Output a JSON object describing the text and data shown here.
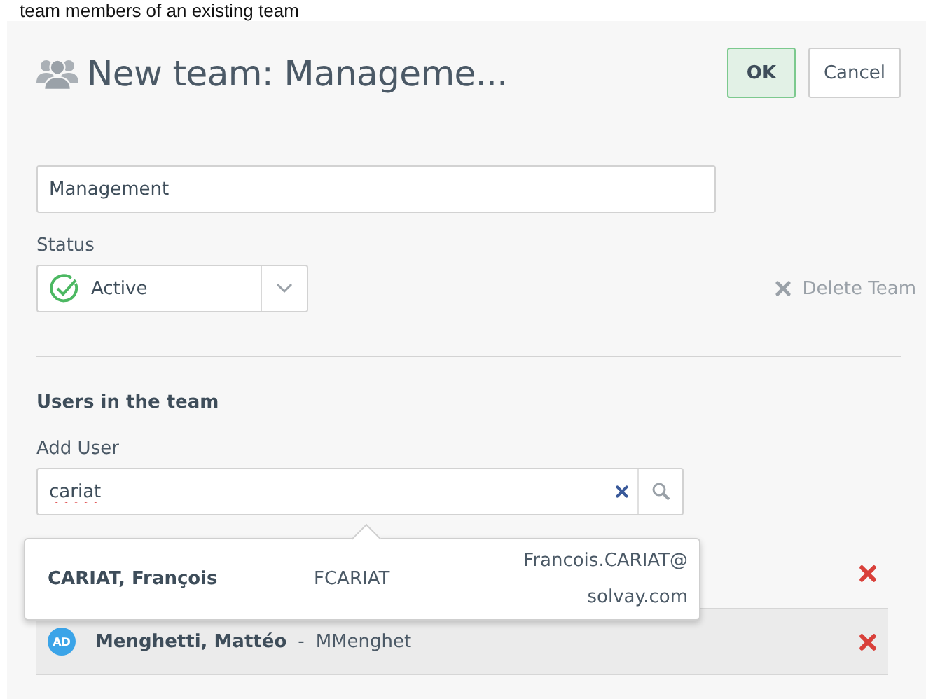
{
  "caption": "team members of an existing team",
  "header": {
    "title": "New team: Manageme...",
    "buttons": [
      {
        "label": "OK",
        "kind": "primary"
      },
      {
        "label": "Cancel",
        "kind": "secondary"
      }
    ]
  },
  "name_field": {
    "value": "Management"
  },
  "status": {
    "label": "Status",
    "value": "Active",
    "active": true
  },
  "delete_button": {
    "label": "Delete Team"
  },
  "users_section": {
    "title": "Users in the team",
    "add_label": "Add User",
    "search": {
      "value": "cariat",
      "misspelled": true
    }
  },
  "suggestion": {
    "name": "CARIAT, François",
    "login": "FCARIAT",
    "email_lines": [
      "Francois.CARIAT@",
      "solvay.com"
    ]
  },
  "members": [
    {
      "covered": true,
      "highlighted": false
    },
    {
      "covered": false,
      "highlighted": true,
      "badge": "AD",
      "name": "Menghetti, Mattéo",
      "separator": "-",
      "login": "MMenghet"
    }
  ]
}
